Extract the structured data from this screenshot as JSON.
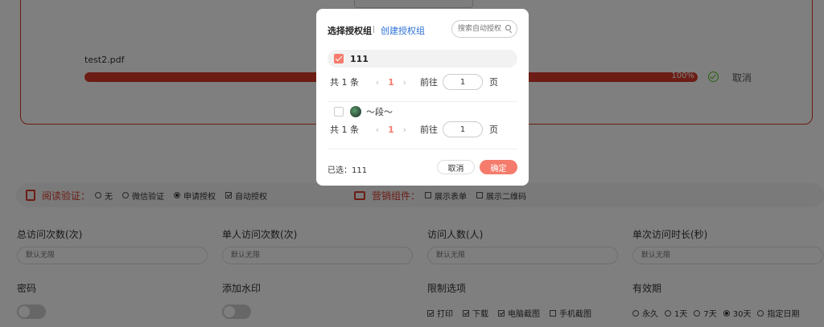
{
  "upload": {
    "file_name": "test2.pdf",
    "progress_text": "100%",
    "progress_pct": 100,
    "cancel_label": "取消"
  },
  "verify_bar": {
    "read_title": "阅读验证：",
    "read_options": [
      "无",
      "微信验证",
      "申请授权"
    ],
    "read_selected": "申请授权",
    "auto_auth_label": "自动授权",
    "auto_auth_checked": true,
    "marketing_title": "营销组件：",
    "marketing_options": [
      "展示表单",
      "展示二维码"
    ]
  },
  "fields": {
    "total_visits": {
      "label": "总访问次数(次)",
      "placeholder": "默认无限"
    },
    "single_visits": {
      "label": "单人访问次数(次)",
      "placeholder": "默认无限"
    },
    "visitors": {
      "label": "访问人数(人)",
      "placeholder": "默认无限"
    },
    "duration": {
      "label": "单次访问时长(秒)",
      "placeholder": "默认无限"
    },
    "password": {
      "label": "密码"
    },
    "watermark": {
      "label": "添加水印"
    },
    "restrictions": {
      "label": "限制选项",
      "options": [
        "打印",
        "下载",
        "电脑截图",
        "手机截图"
      ],
      "checked": [
        "打印",
        "下载",
        "电脑截图"
      ]
    },
    "validity": {
      "label": "有效期",
      "options": [
        "永久",
        "1天",
        "7天",
        "30天",
        "指定日期"
      ],
      "selected": "30天"
    }
  },
  "modal": {
    "title": "选择授权组",
    "create_link": "创建授权组",
    "search_placeholder": "搜索自动授权",
    "groups": [
      {
        "label": "111",
        "checked": true,
        "pager": {
          "total": "共 1 条",
          "current": "1",
          "goto_label": "前往",
          "page_input": "1",
          "unit": "页"
        }
      },
      {
        "label": "～段～",
        "checked": false,
        "pager": {
          "total": "共 1 条",
          "current": "1",
          "goto_label": "前往",
          "page_input": "1",
          "unit": "页"
        }
      }
    ],
    "selected_text": "已选：111",
    "cancel_label": "取消",
    "confirm_label": "确定"
  },
  "colors": {
    "accent": "#f57c6c",
    "brand_red": "#d93a2b",
    "link_blue": "#2b6fd6"
  }
}
